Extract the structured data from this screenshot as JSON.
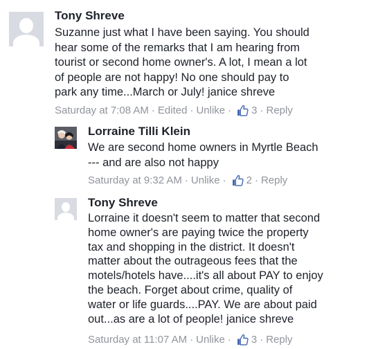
{
  "comments": [
    {
      "author": "Tony Shreve",
      "text": "Suzanne just what I have been saying.  You should\nhear some of the remarks that I am hearing from\ntourist or second home owner's.  A lot, I mean a lot\nof people are not happy!  No one should pay to\npark any time...March or July!  janice shreve",
      "time": "Saturday at 7:08 AM",
      "edited": "Edited",
      "unlike": "Unlike",
      "likes": "3",
      "reply": "Reply",
      "avatar": "default-avatar"
    },
    {
      "author": "Lorraine Tilli Klein",
      "text": "We are second home owners in Myrtle Beach\n--- and are also not happy",
      "time": "Saturday at 9:32 AM",
      "unlike": "Unlike",
      "likes": "2",
      "reply": "Reply",
      "avatar": "photo-avatar"
    },
    {
      "author": "Tony Shreve",
      "text": "Lorraine it doesn't seem to matter that second\nhome owner's are paying twice the property\ntax and shopping in the district.  It doesn't\nmatter about the outrageous fees that the\nmotels/hotels have....it's all about PAY to enjoy\nthe beach.  Forget about crime, quality of\nwater or life guards....PAY.  We are about paid\nout...as are a lot of people!   janice shreve",
      "time": "Saturday at 11:07 AM",
      "unlike": "Unlike",
      "likes": "3",
      "reply": "Reply",
      "avatar": "default-avatar"
    }
  ],
  "colors": {
    "name": "#1d2129",
    "meta": "#90949c",
    "like_blue": "#4267b2",
    "avatar_bg": "#d8dbe2"
  },
  "separator": "·"
}
